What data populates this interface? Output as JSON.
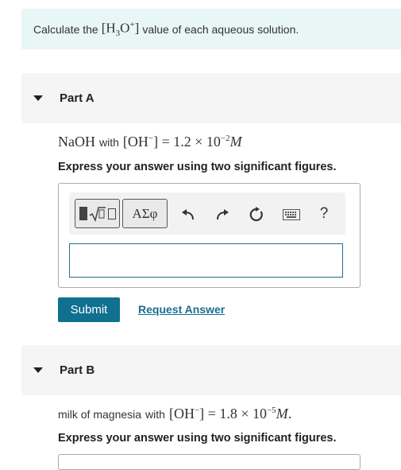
{
  "intro": {
    "text_before": "Calculate the",
    "formula": "[H3O+]",
    "text_after": "value of each aqueous solution."
  },
  "partA": {
    "title": "Part A",
    "question": {
      "species": "NaOH",
      "with": "with",
      "expression": "[OH−] = 1.2 × 10−2 M"
    },
    "instruction": "Express your answer using two significant figures.",
    "toolbar": {
      "greek_label": "ΑΣφ",
      "help_label": "?"
    },
    "answer_value": "",
    "submit_label": "Submit",
    "request_label": "Request Answer"
  },
  "partB": {
    "title": "Part B",
    "question": {
      "species": "milk of magnesia",
      "with": "with",
      "expression": "[OH−] = 1.8 × 10−5 M."
    },
    "instruction": "Express your answer using two significant figures."
  },
  "colors": {
    "intro_bg": "#e8f6f5",
    "submit_bg": "#10708f",
    "link": "#1a6e90"
  },
  "icons": [
    "templates-icon",
    "greek-letters-icon",
    "undo-icon",
    "redo-icon",
    "reset-icon",
    "keyboard-icon",
    "help-icon"
  ]
}
